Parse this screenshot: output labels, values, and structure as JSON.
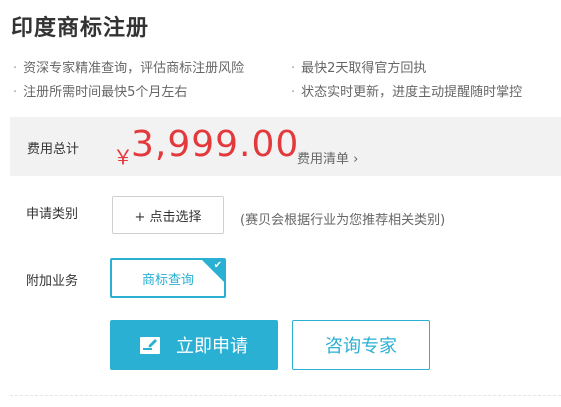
{
  "page": {
    "title": "印度商标注册"
  },
  "features": [
    "资深专家精准查询，评估商标注册风险",
    "最快2天取得官方回执",
    "注册所需时间最快5个月左右",
    "状态实时更新，进度主动提醒随时掌控"
  ],
  "price": {
    "label": "费用总计",
    "currency": "￥",
    "amount": "3,999.00",
    "list_link": "费用清单",
    "list_link_chevron": "›"
  },
  "category": {
    "label": "申请类别",
    "button": "+ 点击选择",
    "hint": "(赛贝会根据行业为您推荐相关类别)"
  },
  "addon": {
    "label": "附加业务",
    "service": "商标查询",
    "selected": true
  },
  "actions": {
    "apply": "立即申请",
    "consult": "咨询专家"
  },
  "colors": {
    "accent": "#2ab0d3",
    "price": "#e4393c",
    "price_bg": "#f2f2f2"
  },
  "icons": {
    "bullet": "bullet-dot-icon",
    "checkmark": "checkmark-icon",
    "apply": "edit-form-icon",
    "chevron": "chevron-right-icon"
  }
}
